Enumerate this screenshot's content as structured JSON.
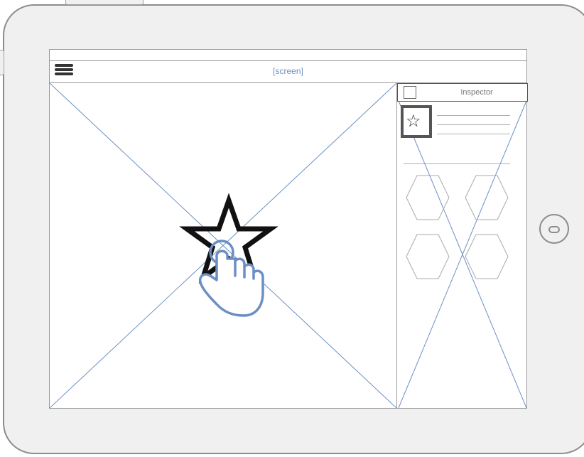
{
  "device": {
    "type": "tablet-landscape"
  },
  "header": {
    "menu_icon": "hamburger-menu-icon",
    "title": "[screen]"
  },
  "inspector": {
    "title": "Inspector",
    "checkbox_checked": false,
    "thumbnail_icon": "star-outline-icon",
    "text_line_count": 3,
    "hexagon_count": 4
  },
  "canvas": {
    "content": "image-placeholder",
    "overlay_icons": [
      "star-outline-icon",
      "tap-gesture-hand-icon"
    ]
  },
  "colors": {
    "accent": "#6b8fc4",
    "outline": "#9a9a9a",
    "device_body": "#f0f0f0"
  }
}
